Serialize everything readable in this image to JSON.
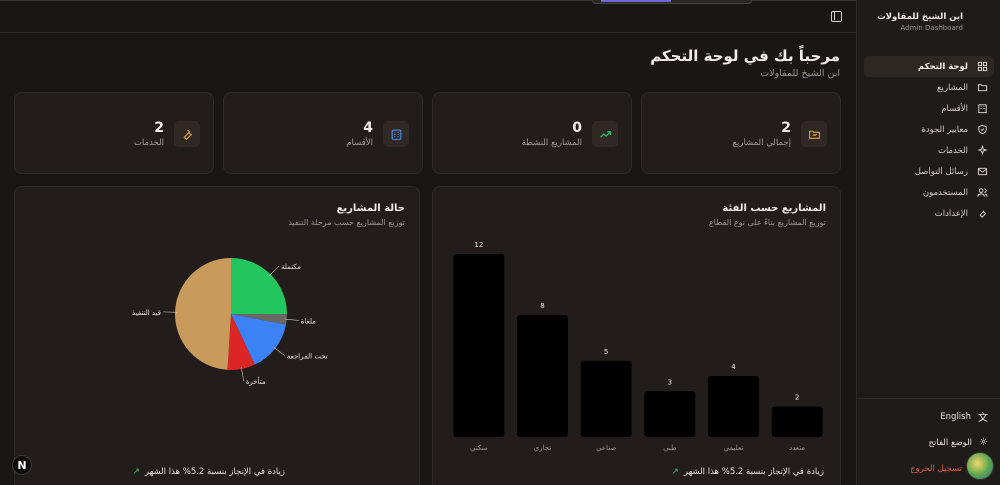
{
  "header": {
    "title": "مرحباً بك في لوحة التحكم",
    "subtitle": "ابن الشيخ للمقاولات"
  },
  "brand": {
    "name": "ابن الشيخ للمقاولات",
    "tagline": "Admin Dashboard"
  },
  "stats": [
    {
      "value": "2",
      "label": "إجمالي المشاريع",
      "icon": "folder-icon",
      "color": "#e8a43a"
    },
    {
      "value": "0",
      "label": "المشاريع النشطة",
      "icon": "trending-up-icon",
      "color": "#2bc46b"
    },
    {
      "value": "4",
      "label": "الأقسام",
      "icon": "building-icon",
      "color": "#4a8fe7"
    },
    {
      "value": "2",
      "label": "الخدمات",
      "icon": "wrench-icon",
      "color": "#e8a43a"
    }
  ],
  "bar_panel": {
    "title": "المشاريع حسب الفئة",
    "subtitle": "توزيع المشاريع بناءً على نوع القطاع",
    "footer": "زيادة في الإنجاز بنسبة 5.2% هذا الشهر"
  },
  "pie_panel": {
    "title": "حالة المشاريع",
    "subtitle": "توزيع المشاريع حسب مرحلة التنفيذ",
    "footer": "زيادة في الإنجاز بنسبة 5.2% هذا الشهر"
  },
  "chart_data": [
    {
      "type": "bar",
      "categories": [
        "سكني",
        "تجاري",
        "صناعي",
        "طبي",
        "تعليمي",
        "متعدد"
      ],
      "values": [
        12,
        8,
        5,
        3,
        4,
        2
      ],
      "ylim": [
        0,
        12
      ],
      "bar_color": "#000000",
      "grid": false
    },
    {
      "type": "pie",
      "labels": [
        "مكتملة",
        "ملغاة",
        "تحت المراجعة",
        "متأخرة",
        "قيد التنفيذ"
      ],
      "values": [
        25,
        3,
        15,
        8,
        49
      ],
      "colors": [
        "#22c55e",
        "#6b6763",
        "#3b82f6",
        "#dc2626",
        "#c89a5c"
      ]
    }
  ],
  "sidebar": {
    "items": [
      {
        "label": "لوحة التحكم",
        "icon": "dashboard-icon",
        "active": true
      },
      {
        "label": "المشاريع",
        "icon": "folder-icon",
        "active": false
      },
      {
        "label": "الأقسام",
        "icon": "building-icon",
        "active": false
      },
      {
        "label": "معايير الجودة",
        "icon": "shield-icon",
        "active": false
      },
      {
        "label": "الخدمات",
        "icon": "sparkles-icon",
        "active": false
      },
      {
        "label": "رسائل التواصل",
        "icon": "mail-icon",
        "active": false
      },
      {
        "label": "المستخدمون",
        "icon": "users-icon",
        "active": false
      },
      {
        "label": "الإعدادات",
        "icon": "wrench-icon",
        "active": false
      }
    ],
    "language": "English",
    "theme": "الوضع الفاتح",
    "logout": "تسجيل الخروج"
  },
  "badge": "N"
}
